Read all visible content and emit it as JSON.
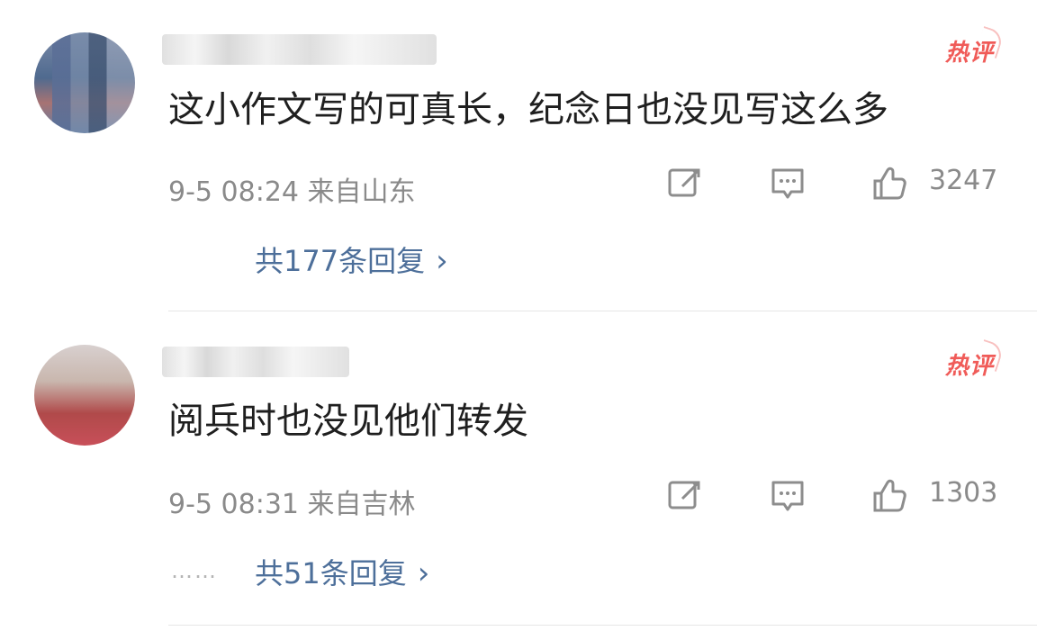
{
  "comments": [
    {
      "badge": "热评",
      "text": "这小作文写的可真长，纪念日也没见写这么多",
      "meta": "9-5 08:24 来自山东",
      "likes": "3247",
      "replies": "共177条回复",
      "reply_chevron": "›"
    },
    {
      "badge": "热评",
      "text": "阅兵时也没见他们转发",
      "meta": "9-5 08:31 来自吉林",
      "likes": "1303",
      "replies": "共51条回复",
      "reply_chevron": "›",
      "reply_dots": "……"
    }
  ],
  "icons": {
    "share": "share-icon",
    "comment": "comment-icon",
    "like": "like-icon"
  },
  "colors": {
    "hot": "#f05b58",
    "reply_link": "#4d6f9a",
    "meta": "#8a8a8a",
    "text": "#1f1f1f"
  }
}
